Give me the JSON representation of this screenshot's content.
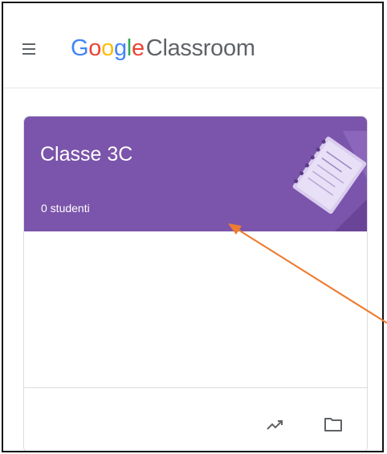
{
  "header": {
    "menu_icon": "hamburger-menu-icon",
    "brand": {
      "google_letters": [
        {
          "char": "G",
          "color": "#4285F4"
        },
        {
          "char": "o",
          "color": "#EA4335"
        },
        {
          "char": "o",
          "color": "#FBBC05"
        },
        {
          "char": "g",
          "color": "#4285F4"
        },
        {
          "char": "l",
          "color": "#34A853"
        },
        {
          "char": "e",
          "color": "#EA4335"
        }
      ],
      "product": "Classroom"
    }
  },
  "class_card": {
    "name": "Classe 3C",
    "students": "0 studenti",
    "header_color": "#7b54ab",
    "footer_icons": [
      "trending-up-icon",
      "folder-icon"
    ]
  },
  "annotation": {
    "arrow_color": "#ed7d31"
  }
}
